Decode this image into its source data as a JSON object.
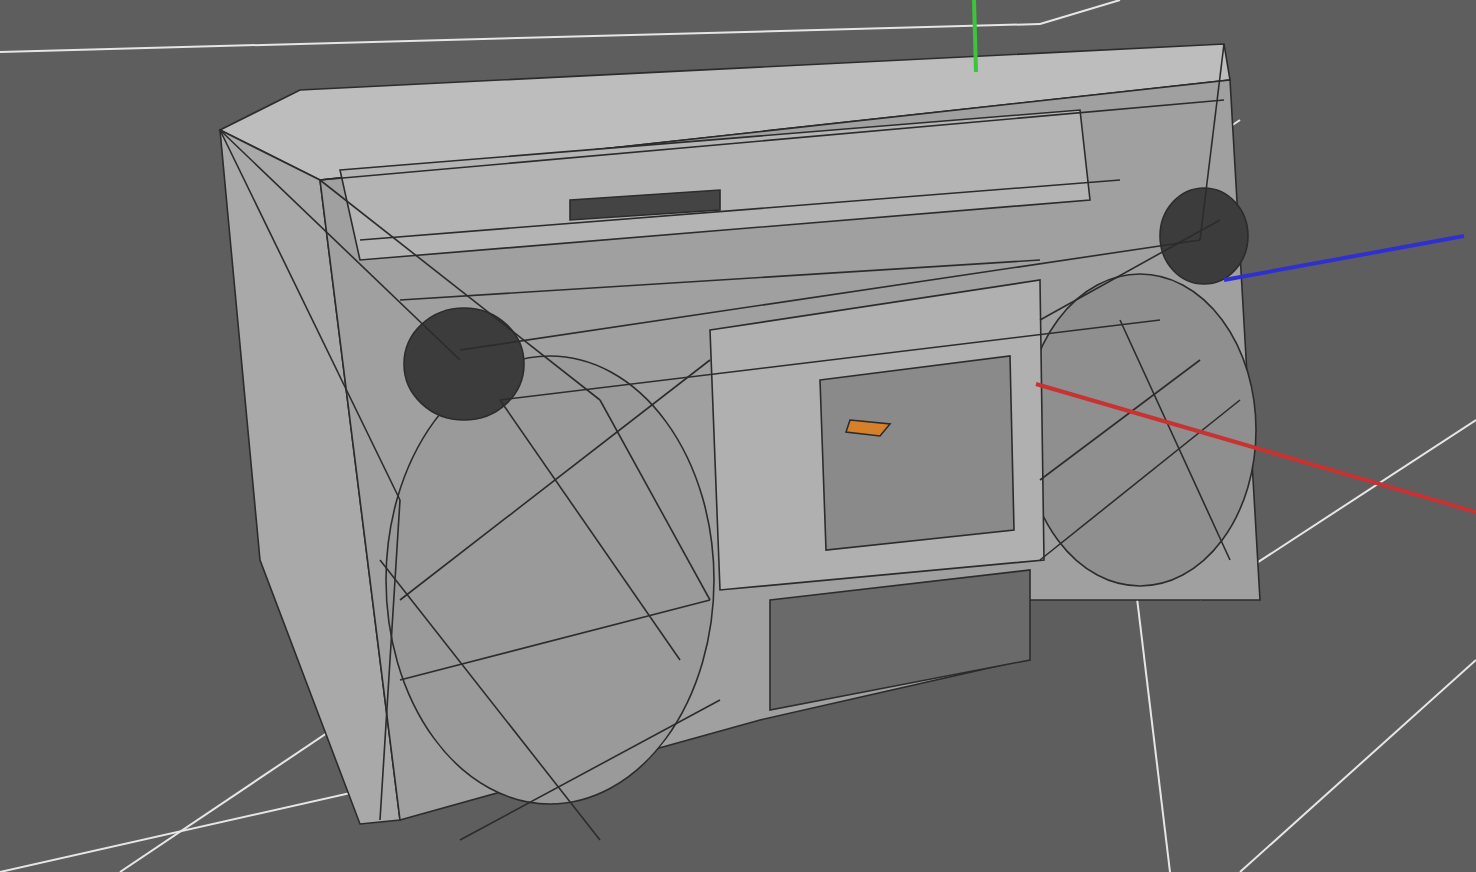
{
  "axes": [
    {
      "kind": "y",
      "color": "#3cc43c"
    },
    {
      "kind": "x",
      "color": "#c83232"
    },
    {
      "kind": "z",
      "color": "#3030d0"
    }
  ]
}
